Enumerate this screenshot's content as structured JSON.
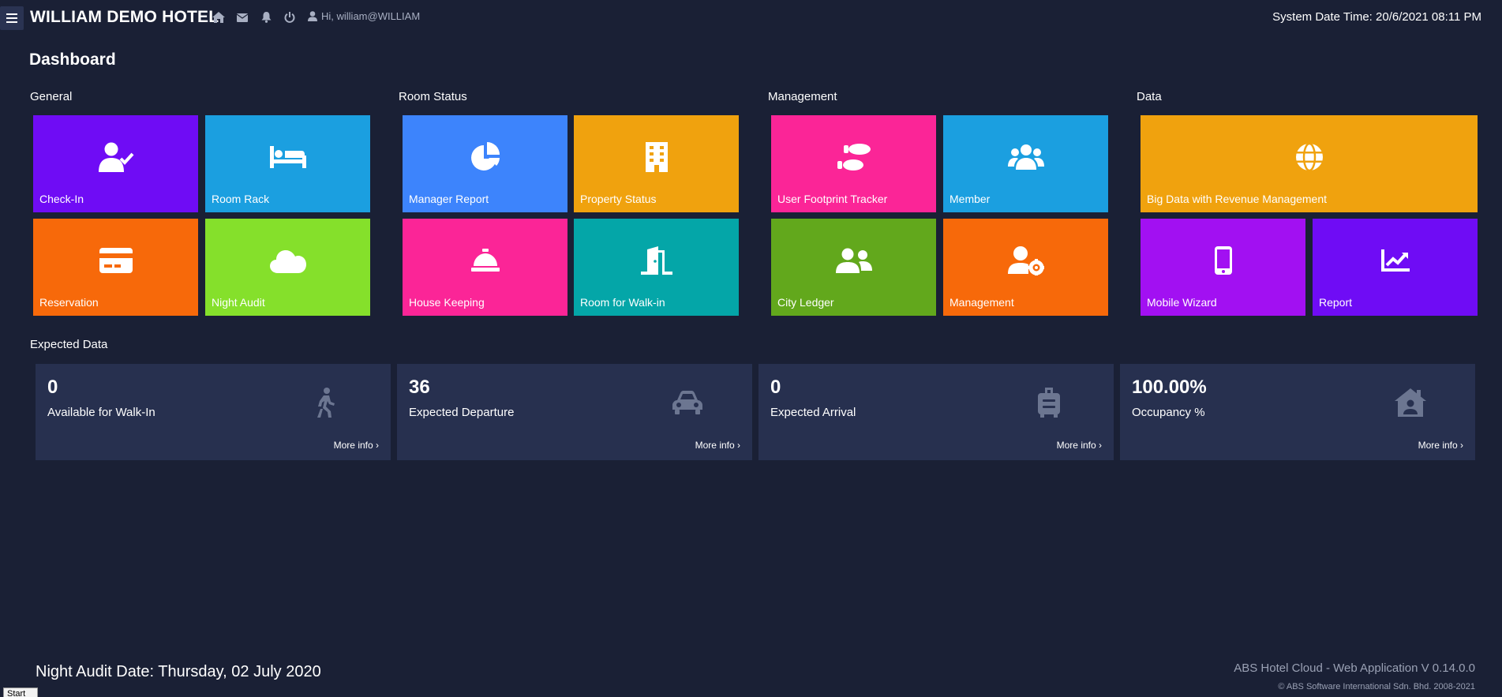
{
  "header": {
    "hotel_name": "WILLIAM DEMO HOTEL",
    "user_greeting": "Hi, william@WILLIAM",
    "system_time": "System Date Time: 20/6/2021 08:11 PM",
    "icons": [
      "home-icon",
      "envelope-icon",
      "bell-icon",
      "power-icon",
      "user-icon"
    ]
  },
  "page": {
    "title": "Dashboard"
  },
  "sections": {
    "general": "General",
    "room_status": "Room Status",
    "management": "Management",
    "data": "Data"
  },
  "tiles": {
    "check_in": {
      "label": "Check-In",
      "color": "#6f0cf5",
      "icon": "user-check-icon"
    },
    "room_rack": {
      "label": "Room Rack",
      "color": "#1b9fe0",
      "icon": "bed-icon"
    },
    "reservation": {
      "label": "Reservation",
      "color": "#f7690a",
      "icon": "credit-card-icon"
    },
    "night_audit": {
      "label": "Night Audit",
      "color": "#85e02b",
      "icon": "cloud-icon"
    },
    "manager_report": {
      "label": "Manager Report",
      "color": "#3d84fc",
      "icon": "pie-chart-icon"
    },
    "property_status": {
      "label": "Property Status",
      "color": "#f0a20e",
      "icon": "building-icon"
    },
    "house_keeping": {
      "label": "House Keeping",
      "color": "#fb2597",
      "icon": "concierge-bell-icon"
    },
    "room_walkin": {
      "label": "Room for Walk-in",
      "color": "#04a6a8",
      "icon": "door-open-icon"
    },
    "footprint": {
      "label": "User Footprint Tracker",
      "color": "#fb2597",
      "icon": "footprints-icon"
    },
    "member": {
      "label": "Member",
      "color": "#1b9fe0",
      "icon": "users-icon"
    },
    "city_ledger": {
      "label": "City Ledger",
      "color": "#62a81c",
      "icon": "user-friends-icon"
    },
    "management": {
      "label": "Management",
      "color": "#f7690a",
      "icon": "user-cog-icon"
    },
    "big_data": {
      "label": "Big Data with Revenue Management",
      "color": "#f0a20e",
      "icon": "globe-icon"
    },
    "mobile_wizard": {
      "label": "Mobile Wizard",
      "color": "#a210f2",
      "icon": "mobile-icon"
    },
    "report": {
      "label": "Report",
      "color": "#6f0cf5",
      "icon": "chart-line-icon"
    }
  },
  "expected": {
    "title": "Expected Data",
    "more_info": "More info ›",
    "items": [
      {
        "value": "0",
        "label": "Available for Walk-In",
        "icon": "walking-icon"
      },
      {
        "value": "36",
        "label": "Expected Departure",
        "icon": "car-icon"
      },
      {
        "value": "0",
        "label": "Expected Arrival",
        "icon": "suitcase-icon"
      },
      {
        "value": "100.00%",
        "label": "Occupancy %",
        "icon": "house-user-icon"
      }
    ]
  },
  "footer": {
    "night_audit_date": "Night Audit Date: Thursday, 02 July 2020",
    "version": "ABS Hotel Cloud - Web Application V 0.14.0.0",
    "copyright": "© ABS Software International Sdn. Bhd. 2008-2021",
    "start_button": "Start"
  }
}
